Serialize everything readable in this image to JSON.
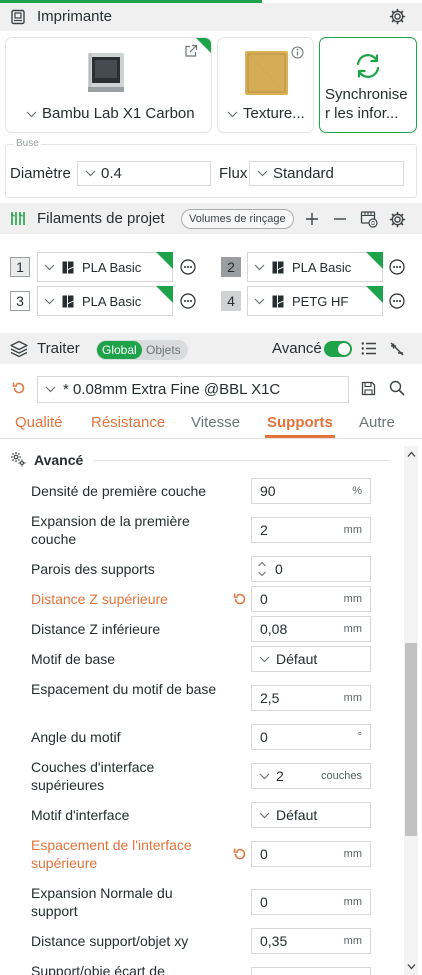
{
  "printer": {
    "section_title": "Imprimante",
    "printer_name": "Bambu Lab X1 Carbon",
    "plate_name": "Texture...",
    "sync_label_line1": "Synchronise",
    "sync_label_line2": "r les infor...",
    "nozzle_group": "Buse",
    "diameter_label": "Diamètre",
    "diameter_value": "0.4",
    "flow_label": "Flux",
    "flow_value": "Standard"
  },
  "filaments": {
    "section_title": "Filaments de projet",
    "flush_button": "Volumes de rinçage",
    "items": [
      {
        "index": "1",
        "name": "PLA Basic"
      },
      {
        "index": "2",
        "name": "PLA Basic"
      },
      {
        "index": "3",
        "name": "PLA Basic"
      },
      {
        "index": "4",
        "name": "PETG HF"
      }
    ]
  },
  "process": {
    "section_title": "Traiter",
    "toggle_global": "Global",
    "toggle_objects": "Objets",
    "advanced_label": "Avancé",
    "preset_name": "* 0.08mm Extra Fine @BBL X1C",
    "tabs": [
      "Qualité",
      "Résistance",
      "Vitesse",
      "Supports",
      "Autre"
    ],
    "active_tab": "Supports",
    "group_title": "Avancé"
  },
  "params": [
    {
      "label": "Densité de première couche",
      "value": "90",
      "unit": "%"
    },
    {
      "label": "Expansion de la première couche",
      "value": "2",
      "unit": "mm"
    },
    {
      "label": "Parois des supports",
      "value": "0",
      "unit": ""
    },
    {
      "label": "Distance Z supérieure",
      "value": "0",
      "unit": "mm"
    },
    {
      "label": "Distance Z inférieure",
      "value": "0,08",
      "unit": "mm"
    },
    {
      "label": "Motif de base",
      "value": "Défaut",
      "unit": ""
    },
    {
      "label": "Espacement du motif de base",
      "value": "2,5",
      "unit": "mm"
    },
    {
      "label": "Angle du motif",
      "value": "0",
      "unit": "°"
    },
    {
      "label": "Couches d'interface supérieures",
      "value": "2",
      "unit": "couches"
    },
    {
      "label": "Motif d'interface",
      "value": "Défaut",
      "unit": ""
    },
    {
      "label": "Espacement de l'interface supérieure",
      "value": "0",
      "unit": "mm"
    },
    {
      "label": "Expansion Normale du support",
      "value": "0",
      "unit": "mm"
    },
    {
      "label": "Distance support/objet xy",
      "value": "0,35",
      "unit": "mm"
    },
    {
      "label": "Support/obje écart de",
      "value": "",
      "unit": ""
    }
  ],
  "colors": {
    "accent_green": "#1fa34a",
    "modified_orange": "#e2733b",
    "section_bg": "#f0f0f1"
  }
}
